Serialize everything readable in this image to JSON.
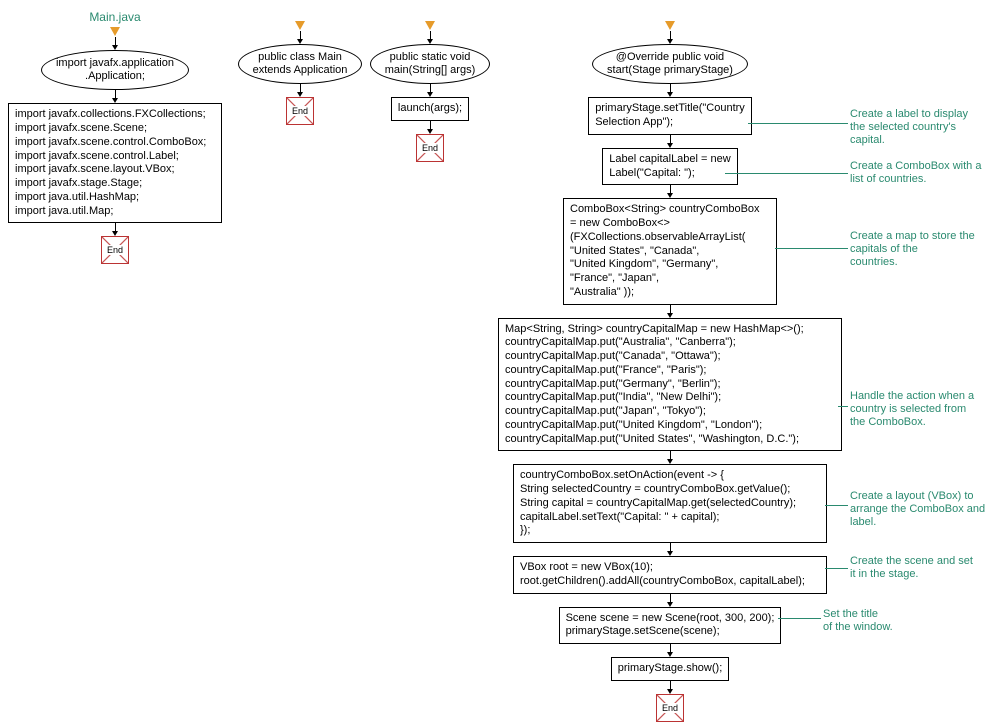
{
  "title": "Main.java",
  "col1": {
    "oval": "import javafx.application\n.Application;",
    "box": "import javafx.collections.FXCollections;\nimport javafx.scene.Scene;\nimport javafx.scene.control.ComboBox;\nimport javafx.scene.control.Label;\nimport javafx.scene.layout.VBox;\nimport javafx.stage.Stage;\nimport java.util.HashMap;\nimport java.util.Map;"
  },
  "col2": {
    "oval": "public class Main\nextends Application"
  },
  "col3": {
    "oval": "public static void\nmain(String[] args)",
    "box": "launch(args);"
  },
  "col4": {
    "oval": "@Override public void\nstart(Stage primaryStage)",
    "box1": "primaryStage.setTitle(\"Country\nSelection App\");",
    "box2": "Label capitalLabel = new\nLabel(\"Capital: \");",
    "box3": "ComboBox<String> countryComboBox\n= new ComboBox<>\n(FXCollections.observableArrayList(\n\"United States\", \"Canada\",\n\"United Kingdom\", \"Germany\",\n\"France\", \"Japan\",\n\"Australia\" ));",
    "box4": "Map<String, String> countryCapitalMap = new HashMap<>();\ncountryCapitalMap.put(\"Australia\", \"Canberra\");\ncountryCapitalMap.put(\"Canada\", \"Ottawa\");\ncountryCapitalMap.put(\"France\", \"Paris\");\ncountryCapitalMap.put(\"Germany\", \"Berlin\");\ncountryCapitalMap.put(\"India\", \"New Delhi\");\ncountryCapitalMap.put(\"Japan\", \"Tokyo\");\ncountryCapitalMap.put(\"United Kingdom\", \"London\");\ncountryCapitalMap.put(\"United States\", \"Washington, D.C.\");",
    "box5": "countryComboBox.setOnAction(event -> {\nString selectedCountry = countryComboBox.getValue();\nString capital = countryCapitalMap.get(selectedCountry);\ncapitalLabel.setText(\"Capital: \" + capital);\n});",
    "box6": "VBox root = new VBox(10);\nroot.getChildren().addAll(countryComboBox, capitalLabel);",
    "box7": "Scene scene = new Scene(root, 300, 200);\nprimaryStage.setScene(scene);",
    "box8": "primaryStage.show();"
  },
  "end_label": "End",
  "annots": {
    "a1": "Create a label to display\nthe selected country's\ncapital.",
    "a2": "Create a ComboBox with a\nlist of countries.",
    "a3": "Create a map to store the\ncapitals of the\ncountries.",
    "a4": "Handle the action when a\ncountry is selected from\nthe ComboBox.",
    "a5": "Create a layout (VBox) to\narrange the ComboBox and\nlabel.",
    "a6": "Create the scene and set\nit in the stage.",
    "a7": "Set the title\nof the window."
  }
}
